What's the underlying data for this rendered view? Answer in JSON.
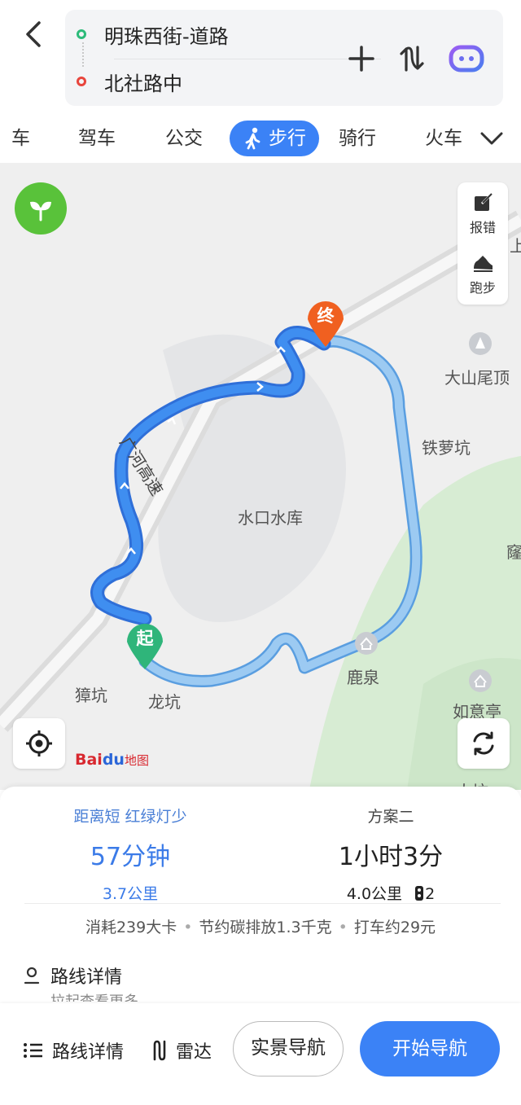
{
  "header": {
    "start": "明珠西街-道路",
    "end": "北社路中"
  },
  "tabs": [
    {
      "label": "车"
    },
    {
      "label": "驾车"
    },
    {
      "label": "公交"
    },
    {
      "label": "步行",
      "active": true
    },
    {
      "label": "骑行"
    },
    {
      "label": "火车"
    }
  ],
  "map": {
    "report_label": "报错",
    "run_label": "跑步",
    "start_pin": "起",
    "end_pin": "终",
    "labels": {
      "highway": "广河高速",
      "reservoir": "水口水库",
      "dashanweiding": "大山尾顶",
      "tieluokeng": "铁萝坑",
      "luquan": "鹿泉",
      "ruyiting": "如意亭",
      "zhangkeng": "獐坑",
      "longkeng": "龙坑",
      "edge_top": "上",
      "edge_right": "窿",
      "edge_bottom": "大坑"
    },
    "logo": {
      "bai": "Bai",
      "du": "du",
      "ditu": "地图"
    }
  },
  "plans": [
    {
      "tag": "距离短 红绿灯少",
      "time": "57分钟",
      "distance": "3.7公里"
    },
    {
      "tag": "方案二",
      "time": "1小时3分",
      "distance": "4.0公里",
      "lights": "2"
    }
  ],
  "stats": {
    "calories": "消耗239大卡",
    "carbon": "节约碳排放1.3千克",
    "taxi": "打车约29元"
  },
  "detail": {
    "title": "路线详情",
    "sub": "拉起查看更多"
  },
  "bottombar": {
    "details": "路线详情",
    "radar": "雷达",
    "live_nav": "实景导航",
    "start_nav": "开始导航"
  },
  "colors": {
    "accent": "#3b82f6",
    "route_primary": "#3b7be8",
    "route_alt": "#9ccaf2",
    "start_pin": "#2fb57a",
    "end_pin": "#f06020",
    "eco": "#59c23a"
  }
}
